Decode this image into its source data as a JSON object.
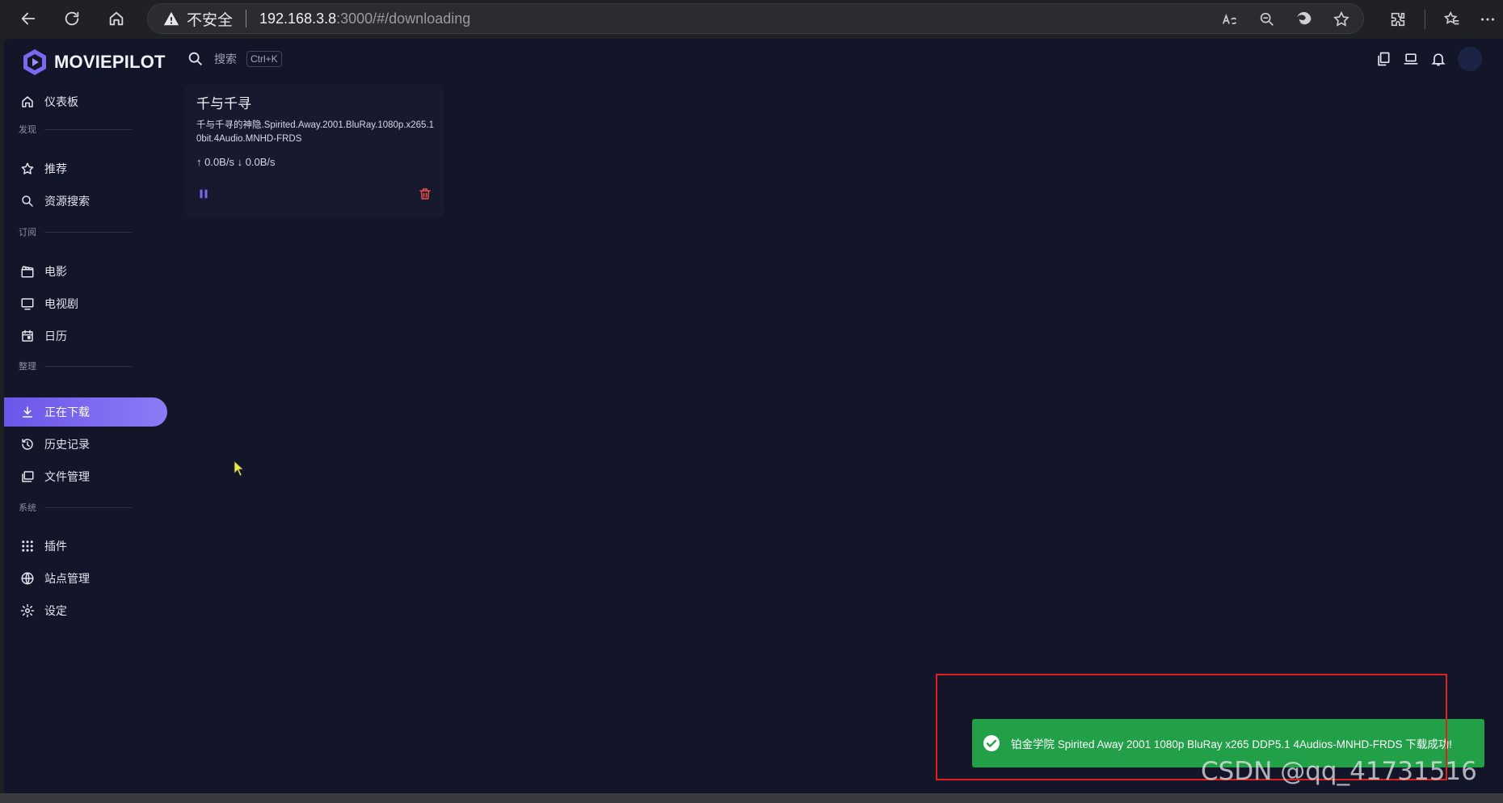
{
  "browser": {
    "security_label": "不安全",
    "url_host": "192.168.3.8",
    "url_rest": ":3000/#/downloading"
  },
  "app": {
    "logo_text": "MOVIEPILOT",
    "search_placeholder": "搜索",
    "search_shortcut": "Ctrl+K"
  },
  "sidebar": {
    "dashboard": "仪表板",
    "sections": {
      "discover": "发现",
      "subscribe": "订阅",
      "manage": "整理",
      "system": "系统"
    },
    "items": {
      "recommend": "推荐",
      "resource_search": "资源搜索",
      "movies": "电影",
      "tv": "电视剧",
      "calendar": "日历",
      "downloading": "正在下载",
      "history": "历史记录",
      "file_manager": "文件管理",
      "plugins": "插件",
      "sites": "站点管理",
      "settings": "设定"
    }
  },
  "download_card": {
    "title": "千与千寻",
    "filename": "千与千寻的神隐.Spirited.Away.2001.BluRay.1080p.x265.10bit.4Audio.MNHD-FRDS",
    "speed": "↑ 0.0B/s ↓ 0.0B/s"
  },
  "toast": {
    "message": "铂金学院 Spirited Away 2001 1080p BluRay x265 DDP5.1 4Audios-MNHD-FRDS 下载成功!"
  },
  "watermark": "CSDN @qq_41731516",
  "colors": {
    "app_bg": "#131628",
    "accent": "#7b68ee",
    "toast_bg": "#21a048",
    "highlight": "#e02020",
    "danger": "#f0504a"
  }
}
